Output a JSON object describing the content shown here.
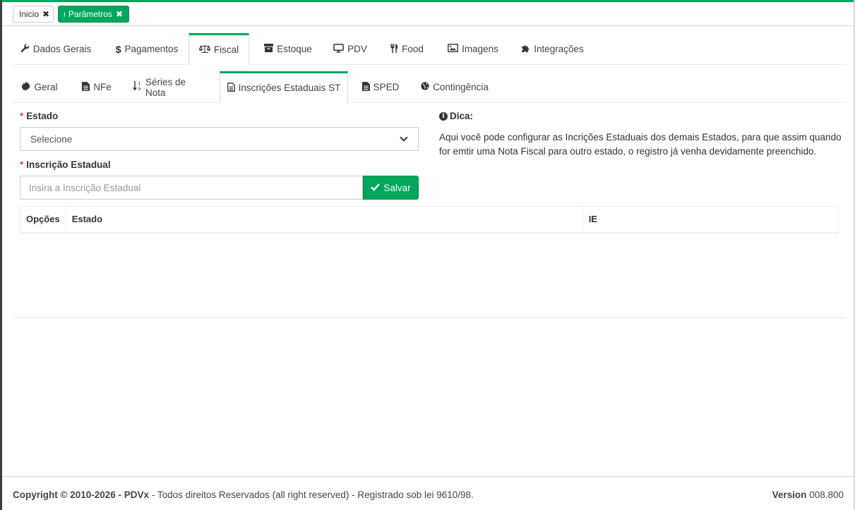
{
  "page_tabs": [
    {
      "label": "Inicio",
      "close": "✖"
    },
    {
      "label": "Parâmetros",
      "close": "✖"
    }
  ],
  "main_tabs": [
    {
      "label": "Dados Gerais",
      "icon": "wrench-icon"
    },
    {
      "label": "Pagamentos",
      "icon": "dollar-icon"
    },
    {
      "label": "Fiscal",
      "icon": "balance-scale-icon"
    },
    {
      "label": "Estoque",
      "icon": "archive-icon"
    },
    {
      "label": "PDV",
      "icon": "desktop-icon"
    },
    {
      "label": "Food",
      "icon": "cutlery-icon"
    },
    {
      "label": "Imagens",
      "icon": "image-icon"
    },
    {
      "label": "Integrações",
      "icon": "puzzle-icon"
    }
  ],
  "sub_tabs": [
    {
      "label": "Geral",
      "icon": "certificate-icon"
    },
    {
      "label": "NFe",
      "icon": "file-icon"
    },
    {
      "label": "Séries de Nota",
      "icon": "sort-numeric-icon"
    },
    {
      "label": "Inscrições Estaduais ST",
      "icon": "file-text-icon"
    },
    {
      "label": "SPED",
      "icon": "file-icon"
    },
    {
      "label": "Contingência",
      "icon": "globe-icon"
    }
  ],
  "form": {
    "estado_label": "Estado",
    "estado_value": "Selecione",
    "ie_label": "Inscrição Estadual",
    "ie_placeholder": "Insira a Inscrição Estadual",
    "required_mark": "*",
    "save_label": "Salvar"
  },
  "tip": {
    "title": "Dica:",
    "text": "Aqui você pode configurar as Incrições Estaduais dos demais Estados, para que assim quando for emtir uma Nota Fiscal para outro estado, o registro já venha devidamente preenchido."
  },
  "table": {
    "columns": [
      "Opções",
      "Estado",
      "IE"
    ]
  },
  "footer": {
    "copyright": "Copyright © 2010-2026 -",
    "brand": "PDVx",
    "rights": "- Todos direitos Reservados (all right reserved) - Registrado sob lei 9610/98.",
    "version_label": "Version",
    "version_value": "008.800"
  },
  "colors": {
    "accent": "#00a65a",
    "required": "#dd4b39"
  }
}
